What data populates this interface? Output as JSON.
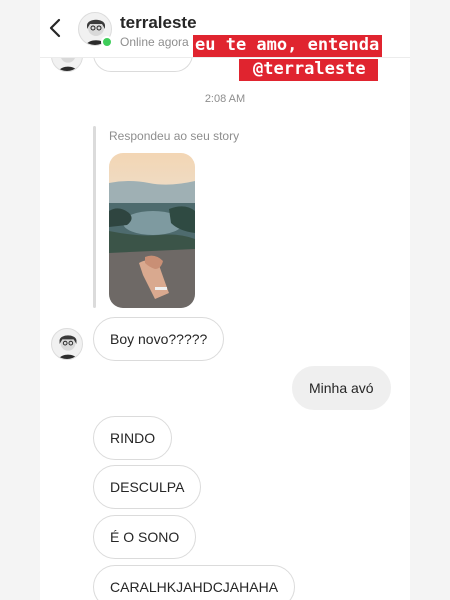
{
  "header": {
    "username": "terraleste",
    "status": "Online agora"
  },
  "overlay": {
    "line1": "eu te amo, entenda",
    "line2": "@terraleste"
  },
  "timestamp": "2:08 AM",
  "story_reply": {
    "label": "Respondeu ao seu story"
  },
  "messages": [
    {
      "text": "Boy novo?????",
      "from": "them"
    },
    {
      "text": "Minha avó",
      "from": "me"
    },
    {
      "text": "RINDO",
      "from": "them"
    },
    {
      "text": "DESCULPA",
      "from": "them"
    },
    {
      "text": "É O SONO",
      "from": "them"
    },
    {
      "text": "CARALHKJAHDCJAHAHA",
      "from": "them"
    }
  ],
  "colors": {
    "overlay_bg": "#e0242f",
    "online": "#3fcd5a",
    "my_bubble": "#efefef"
  }
}
